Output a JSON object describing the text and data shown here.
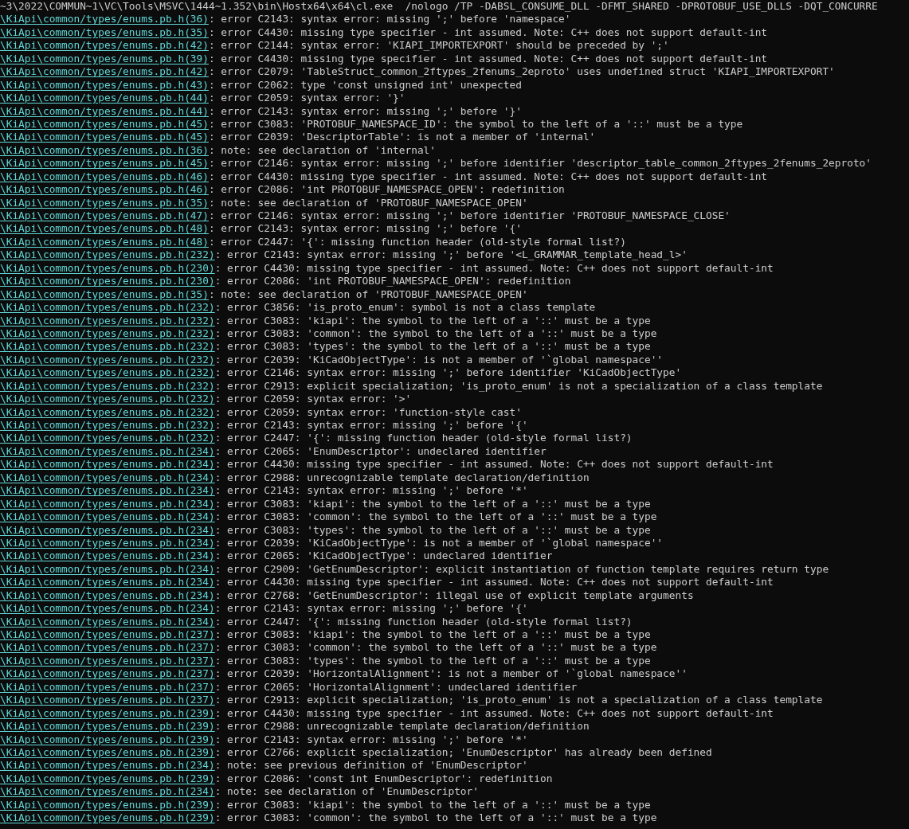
{
  "terminal": {
    "lines": [
      {
        "kind": "command",
        "text": "~3\\2022\\COMMUN~1\\VC\\Tools\\MSVC\\1444~1.352\\bin\\Hostx64\\x64\\cl.exe  /nologo /TP -DABSL_CONSUME_DLL -DFMT_SHARED -DPROTOBUF_USE_DLLS -DQT_CONCURRE"
      },
      {
        "kind": "diagnostic",
        "link": "\\KiApi\\common/types/enums.pb.h(36)",
        "text": ": error C2143: syntax error: missing ';' before 'namespace'"
      },
      {
        "kind": "diagnostic",
        "link": "\\KiApi\\common/types/enums.pb.h(35)",
        "text": ": error C4430: missing type specifier - int assumed. Note: C++ does not support default-int"
      },
      {
        "kind": "diagnostic",
        "link": "\\KiApi\\common/types/enums.pb.h(42)",
        "text": ": error C2144: syntax error: 'KIAPI_IMPORTEXPORT' should be preceded by ';'"
      },
      {
        "kind": "diagnostic",
        "link": "\\KiApi\\common/types/enums.pb.h(39)",
        "text": ": error C4430: missing type specifier - int assumed. Note: C++ does not support default-int"
      },
      {
        "kind": "diagnostic",
        "link": "\\KiApi\\common/types/enums.pb.h(42)",
        "text": ": error C2079: 'TableStruct_common_2ftypes_2fenums_2eproto' uses undefined struct 'KIAPI_IMPORTEXPORT'"
      },
      {
        "kind": "diagnostic",
        "link": "\\KiApi\\common/types/enums.pb.h(43)",
        "text": ": error C2062: type 'const unsigned int' unexpected"
      },
      {
        "kind": "diagnostic",
        "link": "\\KiApi\\common/types/enums.pb.h(44)",
        "text": ": error C2059: syntax error: '}'"
      },
      {
        "kind": "diagnostic",
        "link": "\\KiApi\\common/types/enums.pb.h(44)",
        "text": ": error C2143: syntax error: missing ';' before '}'"
      },
      {
        "kind": "diagnostic",
        "link": "\\KiApi\\common/types/enums.pb.h(45)",
        "text": ": error C3083: 'PROTOBUF_NAMESPACE_ID': the symbol to the left of a '::' must be a type"
      },
      {
        "kind": "diagnostic",
        "link": "\\KiApi\\common/types/enums.pb.h(45)",
        "text": ": error C2039: 'DescriptorTable': is not a member of 'internal'"
      },
      {
        "kind": "diagnostic",
        "link": "\\KiApi\\common/types/enums.pb.h(36)",
        "text": ": note: see declaration of 'internal'"
      },
      {
        "kind": "diagnostic",
        "link": "\\KiApi\\common/types/enums.pb.h(45)",
        "text": ": error C2146: syntax error: missing ';' before identifier 'descriptor_table_common_2ftypes_2fenums_2eproto'"
      },
      {
        "kind": "diagnostic",
        "link": "\\KiApi\\common/types/enums.pb.h(46)",
        "text": ": error C4430: missing type specifier - int assumed. Note: C++ does not support default-int"
      },
      {
        "kind": "diagnostic",
        "link": "\\KiApi\\common/types/enums.pb.h(46)",
        "text": ": error C2086: 'int PROTOBUF_NAMESPACE_OPEN': redefinition"
      },
      {
        "kind": "diagnostic",
        "link": "\\KiApi\\common/types/enums.pb.h(35)",
        "text": ": note: see declaration of 'PROTOBUF_NAMESPACE_OPEN'"
      },
      {
        "kind": "diagnostic",
        "link": "\\KiApi\\common/types/enums.pb.h(47)",
        "text": ": error C2146: syntax error: missing ';' before identifier 'PROTOBUF_NAMESPACE_CLOSE'"
      },
      {
        "kind": "diagnostic",
        "link": "\\KiApi\\common/types/enums.pb.h(48)",
        "text": ": error C2143: syntax error: missing ';' before '{'"
      },
      {
        "kind": "diagnostic",
        "link": "\\KiApi\\common/types/enums.pb.h(48)",
        "text": ": error C2447: '{': missing function header (old-style formal list?)"
      },
      {
        "kind": "diagnostic",
        "link": "\\KiApi\\common/types/enums.pb.h(232)",
        "text": ": error C2143: syntax error: missing ';' before '<L_GRAMMAR_template_head_l>'"
      },
      {
        "kind": "diagnostic",
        "link": "\\KiApi\\common/types/enums.pb.h(230)",
        "text": ": error C4430: missing type specifier - int assumed. Note: C++ does not support default-int"
      },
      {
        "kind": "diagnostic",
        "link": "\\KiApi\\common/types/enums.pb.h(230)",
        "text": ": error C2086: 'int PROTOBUF_NAMESPACE_OPEN': redefinition"
      },
      {
        "kind": "diagnostic",
        "link": "\\KiApi\\common/types/enums.pb.h(35)",
        "text": ": note: see declaration of 'PROTOBUF_NAMESPACE_OPEN'"
      },
      {
        "kind": "diagnostic",
        "link": "\\KiApi\\common/types/enums.pb.h(232)",
        "text": ": error C3856: 'is_proto_enum': symbol is not a class template"
      },
      {
        "kind": "diagnostic",
        "link": "\\KiApi\\common/types/enums.pb.h(232)",
        "text": ": error C3083: 'kiapi': the symbol to the left of a '::' must be a type"
      },
      {
        "kind": "diagnostic",
        "link": "\\KiApi\\common/types/enums.pb.h(232)",
        "text": ": error C3083: 'common': the symbol to the left of a '::' must be a type"
      },
      {
        "kind": "diagnostic",
        "link": "\\KiApi\\common/types/enums.pb.h(232)",
        "text": ": error C3083: 'types': the symbol to the left of a '::' must be a type"
      },
      {
        "kind": "diagnostic",
        "link": "\\KiApi\\common/types/enums.pb.h(232)",
        "text": ": error C2039: 'KiCadObjectType': is not a member of '`global namespace''"
      },
      {
        "kind": "diagnostic",
        "link": "\\KiApi\\common/types/enums.pb.h(232)",
        "text": ": error C2146: syntax error: missing ';' before identifier 'KiCadObjectType'"
      },
      {
        "kind": "diagnostic",
        "link": "\\KiApi\\common/types/enums.pb.h(232)",
        "text": ": error C2913: explicit specialization; 'is_proto_enum' is not a specialization of a class template"
      },
      {
        "kind": "diagnostic",
        "link": "\\KiApi\\common/types/enums.pb.h(232)",
        "text": ": error C2059: syntax error: '>'"
      },
      {
        "kind": "diagnostic",
        "link": "\\KiApi\\common/types/enums.pb.h(232)",
        "text": ": error C2059: syntax error: 'function-style cast'"
      },
      {
        "kind": "diagnostic",
        "link": "\\KiApi\\common/types/enums.pb.h(232)",
        "text": ": error C2143: syntax error: missing ';' before '{'"
      },
      {
        "kind": "diagnostic",
        "link": "\\KiApi\\common/types/enums.pb.h(232)",
        "text": ": error C2447: '{': missing function header (old-style formal list?)"
      },
      {
        "kind": "diagnostic",
        "link": "\\KiApi\\common/types/enums.pb.h(234)",
        "text": ": error C2065: 'EnumDescriptor': undeclared identifier"
      },
      {
        "kind": "diagnostic",
        "link": "\\KiApi\\common/types/enums.pb.h(234)",
        "text": ": error C4430: missing type specifier - int assumed. Note: C++ does not support default-int"
      },
      {
        "kind": "diagnostic",
        "link": "\\KiApi\\common/types/enums.pb.h(234)",
        "text": ": error C2988: unrecognizable template declaration/definition"
      },
      {
        "kind": "diagnostic",
        "link": "\\KiApi\\common/types/enums.pb.h(234)",
        "text": ": error C2143: syntax error: missing ';' before '*'"
      },
      {
        "kind": "diagnostic",
        "link": "\\KiApi\\common/types/enums.pb.h(234)",
        "text": ": error C3083: 'kiapi': the symbol to the left of a '::' must be a type"
      },
      {
        "kind": "diagnostic",
        "link": "\\KiApi\\common/types/enums.pb.h(234)",
        "text": ": error C3083: 'common': the symbol to the left of a '::' must be a type"
      },
      {
        "kind": "diagnostic",
        "link": "\\KiApi\\common/types/enums.pb.h(234)",
        "text": ": error C3083: 'types': the symbol to the left of a '::' must be a type"
      },
      {
        "kind": "diagnostic",
        "link": "\\KiApi\\common/types/enums.pb.h(234)",
        "text": ": error C2039: 'KiCadObjectType': is not a member of '`global namespace''"
      },
      {
        "kind": "diagnostic",
        "link": "\\KiApi\\common/types/enums.pb.h(234)",
        "text": ": error C2065: 'KiCadObjectType': undeclared identifier"
      },
      {
        "kind": "diagnostic",
        "link": "\\KiApi\\common/types/enums.pb.h(234)",
        "text": ": error C2909: 'GetEnumDescriptor': explicit instantiation of function template requires return type"
      },
      {
        "kind": "diagnostic",
        "link": "\\KiApi\\common/types/enums.pb.h(234)",
        "text": ": error C4430: missing type specifier - int assumed. Note: C++ does not support default-int"
      },
      {
        "kind": "diagnostic",
        "link": "\\KiApi\\common/types/enums.pb.h(234)",
        "text": ": error C2768: 'GetEnumDescriptor': illegal use of explicit template arguments"
      },
      {
        "kind": "diagnostic",
        "link": "\\KiApi\\common/types/enums.pb.h(234)",
        "text": ": error C2143: syntax error: missing ';' before '{'"
      },
      {
        "kind": "diagnostic",
        "link": "\\KiApi\\common/types/enums.pb.h(234)",
        "text": ": error C2447: '{': missing function header (old-style formal list?)"
      },
      {
        "kind": "diagnostic",
        "link": "\\KiApi\\common/types/enums.pb.h(237)",
        "text": ": error C3083: 'kiapi': the symbol to the left of a '::' must be a type"
      },
      {
        "kind": "diagnostic",
        "link": "\\KiApi\\common/types/enums.pb.h(237)",
        "text": ": error C3083: 'common': the symbol to the left of a '::' must be a type"
      },
      {
        "kind": "diagnostic",
        "link": "\\KiApi\\common/types/enums.pb.h(237)",
        "text": ": error C3083: 'types': the symbol to the left of a '::' must be a type"
      },
      {
        "kind": "diagnostic",
        "link": "\\KiApi\\common/types/enums.pb.h(237)",
        "text": ": error C2039: 'HorizontalAlignment': is not a member of '`global namespace''"
      },
      {
        "kind": "diagnostic",
        "link": "\\KiApi\\common/types/enums.pb.h(237)",
        "text": ": error C2065: 'HorizontalAlignment': undeclared identifier"
      },
      {
        "kind": "diagnostic",
        "link": "\\KiApi\\common/types/enums.pb.h(237)",
        "text": ": error C2913: explicit specialization; 'is_proto_enum' is not a specialization of a class template"
      },
      {
        "kind": "diagnostic",
        "link": "\\KiApi\\common/types/enums.pb.h(239)",
        "text": ": error C4430: missing type specifier - int assumed. Note: C++ does not support default-int"
      },
      {
        "kind": "diagnostic",
        "link": "\\KiApi\\common/types/enums.pb.h(239)",
        "text": ": error C2988: unrecognizable template declaration/definition"
      },
      {
        "kind": "diagnostic",
        "link": "\\KiApi\\common/types/enums.pb.h(239)",
        "text": ": error C2143: syntax error: missing ';' before '*'"
      },
      {
        "kind": "diagnostic",
        "link": "\\KiApi\\common/types/enums.pb.h(239)",
        "text": ": error C2766: explicit specialization; 'EnumDescriptor' has already been defined"
      },
      {
        "kind": "diagnostic",
        "link": "\\KiApi\\common/types/enums.pb.h(234)",
        "text": ": note: see previous definition of 'EnumDescriptor'"
      },
      {
        "kind": "diagnostic",
        "link": "\\KiApi\\common/types/enums.pb.h(239)",
        "text": ": error C2086: 'const int EnumDescriptor': redefinition"
      },
      {
        "kind": "diagnostic",
        "link": "\\KiApi\\common/types/enums.pb.h(234)",
        "text": ": note: see declaration of 'EnumDescriptor'"
      },
      {
        "kind": "diagnostic",
        "link": "\\KiApi\\common/types/enums.pb.h(239)",
        "text": ": error C3083: 'kiapi': the symbol to the left of a '::' must be a type"
      },
      {
        "kind": "diagnostic",
        "link": "\\KiApi\\common/types/enums.pb.h(239)",
        "text": ": error C3083: 'common': the symbol to the left of a '::' must be a type"
      }
    ]
  }
}
